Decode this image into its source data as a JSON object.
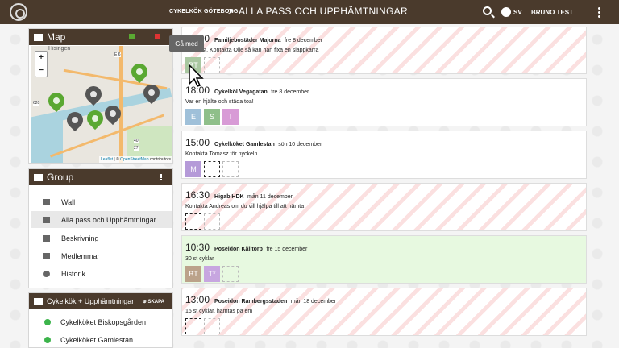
{
  "header": {
    "site": "CYKELKÖK GÖTEBORG",
    "separator": ">",
    "page_title": "ALLA PASS OCH UPPHÄMTNINGAR",
    "lang": "SV",
    "user": "BRUNO TEST"
  },
  "map_panel": {
    "title": "Map",
    "zoom_in": "+",
    "zoom_out": "−",
    "place_label": "Hisingen",
    "road_label_e6": "E 6",
    "road_label_620": "620",
    "road_label_40": "40",
    "road_label_27": "27",
    "attrib_leaflet": "Leaflet",
    "attrib_sep": " | © ",
    "attrib_osm": "OpenStreetMap",
    "attrib_tail": " contributors"
  },
  "group_panel": {
    "title": "Group",
    "items": [
      {
        "label": "Wall"
      },
      {
        "label": "Alla pass och Upphämtningar"
      },
      {
        "label": "Beskrivning"
      },
      {
        "label": "Medlemmar"
      },
      {
        "label": "Historik"
      }
    ]
  },
  "kitchens_panel": {
    "title": "Cykelkök + Upphämtningar",
    "create": "SKAPA",
    "items": [
      {
        "label": "Cykelköket Biskopsgården"
      },
      {
        "label": "Cykelköket Gamlestan"
      }
    ]
  },
  "tooltip": "Gå med",
  "events": [
    {
      "time": "09:30",
      "place": "Familjebostäder Majorna",
      "date": "fre 8 december",
      "desc": "Ca 50 st. Kontakta Olle så kan han fixa en släppkärra",
      "slots": [
        {
          "label": "BT",
          "color": "#a9c7a0"
        },
        {
          "label": "",
          "color": ""
        }
      ]
    },
    {
      "time": "18:00",
      "place": "Cykelköl Vegagatan",
      "date": "fre 8 december",
      "desc": "Var en hjälte och städa toa!",
      "slots": [
        {
          "label": "E",
          "color": "#9fc0d9"
        },
        {
          "label": "S",
          "color": "#8fbf8a"
        },
        {
          "label": "I",
          "color": "#d89bd6"
        }
      ]
    },
    {
      "time": "15:00",
      "place": "Cykelköket Gamlestan",
      "date": "sön 10 december",
      "desc": "Kontakta Tomasz för nyckeln",
      "slots": [
        {
          "label": "M",
          "color": "#b59ad8"
        },
        {
          "label": "",
          "color": ""
        },
        {
          "label": "",
          "color": ""
        }
      ]
    },
    {
      "time": "16:30",
      "place": "Higab HDK",
      "date": "mån 11 december",
      "desc": "Kontakta Andreas om du vill hjälpa till att hämta",
      "slots": [
        {
          "label": "",
          "color": ""
        },
        {
          "label": "",
          "color": ""
        }
      ]
    },
    {
      "time": "10:30",
      "place": "Poseidon Kålltorp",
      "date": "fre 15 december",
      "desc": "30 st cyklar",
      "slots": [
        {
          "label": "BT",
          "color": "#bba28a"
        },
        {
          "label": "T*",
          "color": "#c7a6e0"
        },
        {
          "label": "",
          "color": ""
        }
      ]
    },
    {
      "time": "13:00",
      "place": "Poseidon Rambergsstaden",
      "date": "mån 18 december",
      "desc": "16 st cyklar, hämtas pa em",
      "slots": [
        {
          "label": "",
          "color": ""
        },
        {
          "label": "",
          "color": ""
        }
      ]
    }
  ]
}
